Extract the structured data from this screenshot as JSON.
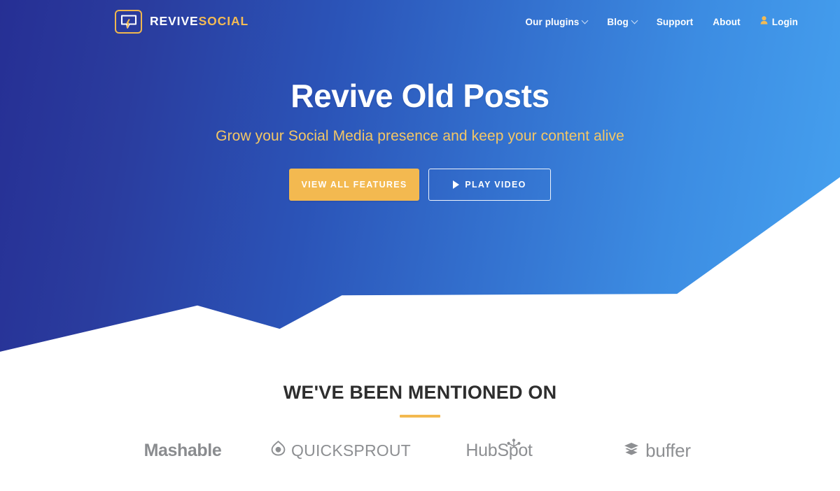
{
  "header": {
    "brand": {
      "icon": "speech-bubble-bolt-icon",
      "word1": "REVIVE",
      "word2": "SOCIAL"
    },
    "nav": [
      {
        "label": "Our plugins",
        "has_dropdown": true,
        "icon": null
      },
      {
        "label": "Blog",
        "has_dropdown": true,
        "icon": null
      },
      {
        "label": "Support",
        "has_dropdown": false,
        "icon": null
      },
      {
        "label": "About",
        "has_dropdown": false,
        "icon": null
      },
      {
        "label": "Login",
        "has_dropdown": false,
        "icon": "user-icon"
      }
    ]
  },
  "hero": {
    "title": "Revive Old Posts",
    "subtitle": "Grow your Social Media presence and keep your content alive",
    "primary_button": "VIEW ALL FEATURES",
    "secondary_button": "PLAY VIDEO",
    "secondary_button_icon": "play-icon"
  },
  "mentions": {
    "title": "WE'VE BEEN MENTIONED ON",
    "logos": [
      {
        "name": "Mashable",
        "icon": null
      },
      {
        "name": "QUICKSPROUT",
        "icon": "quicksprout-drop-icon"
      },
      {
        "name": "HubSpot",
        "icon": "hubspot-sprocket-icon"
      },
      {
        "name": "buffer",
        "icon": "buffer-layers-icon"
      }
    ]
  },
  "colors": {
    "gradient_start": "#262F94",
    "gradient_end": "#46A2F0",
    "accent_gold": "#F3B950",
    "subtitle_gold": "#F4C765",
    "heading_dark": "#2E2E2E",
    "logo_gray": "#8D8F92",
    "page_background": "#FFFFFF"
  }
}
